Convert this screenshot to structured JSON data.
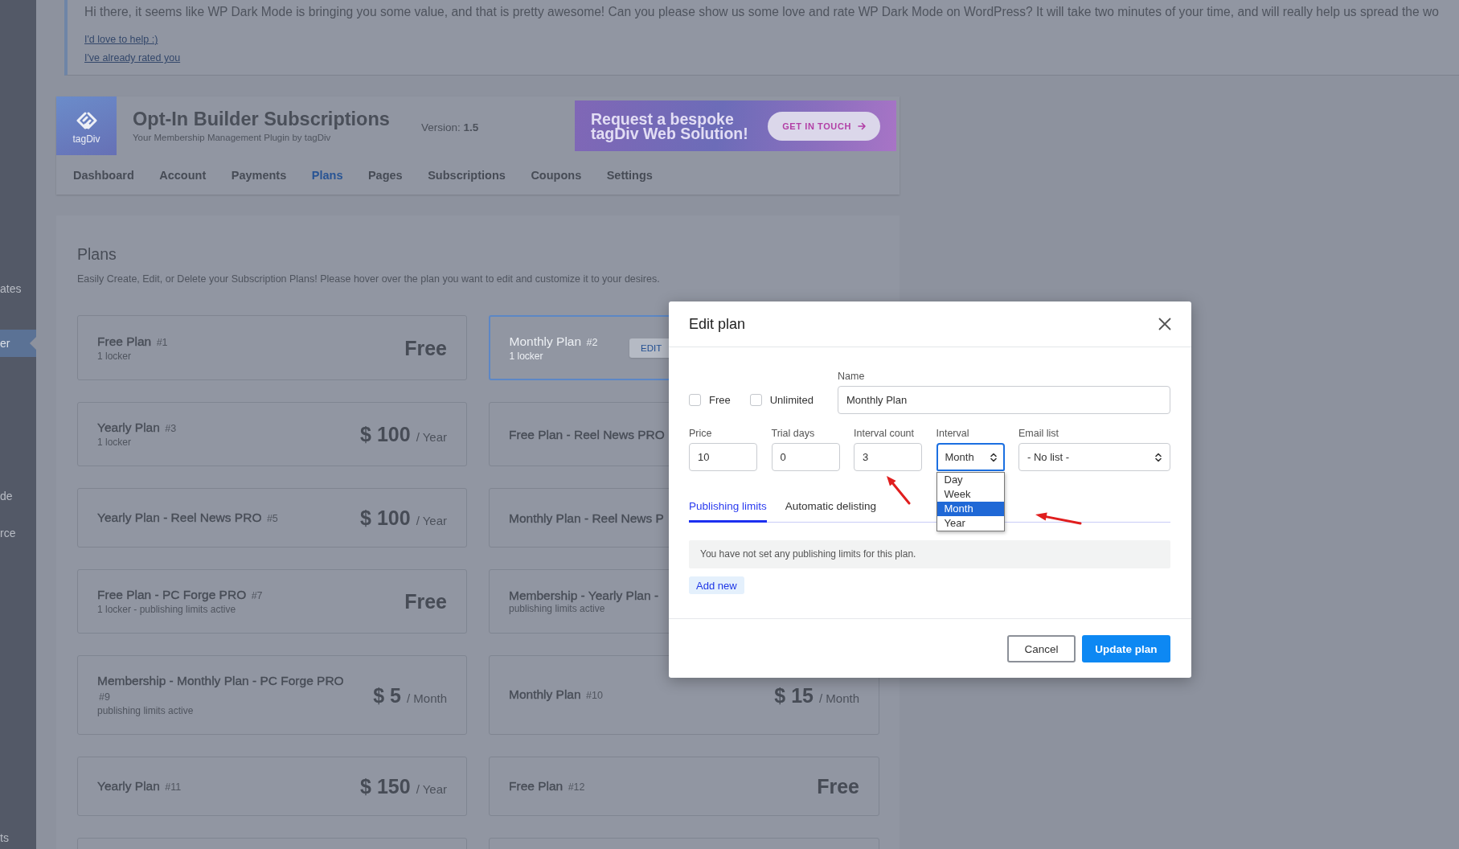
{
  "sidebar": {
    "items": [
      {
        "label": "ates",
        "selected": false
      },
      {
        "label": "er",
        "selected": true
      },
      {
        "label": "de",
        "selected": false
      },
      {
        "label": "rce",
        "selected": false
      },
      {
        "label": "ts",
        "selected": false
      }
    ]
  },
  "notice": {
    "text": "Hi there, it seems like WP Dark Mode is bringing you some value, and that is pretty awesome! Can you please show us some love and rate WP Dark Mode on WordPress? It will take two minutes of your time, and will really help us spread the wo",
    "links": [
      "I'd love to help :)",
      "I've already rated you"
    ]
  },
  "header": {
    "logo_text": "tagDiv",
    "title": "Opt-In Builder Subscriptions",
    "subtitle": "Your Membership Management Plugin by tagDiv",
    "version": "Version: **1.5**",
    "banner": {
      "headline": "Request a bespoke tagDiv Web Solution!",
      "button": "GET IN TOUCH"
    },
    "nav": [
      {
        "label": "Dashboard",
        "selected": false
      },
      {
        "label": "Account",
        "selected": false
      },
      {
        "label": "Payments",
        "selected": false
      },
      {
        "label": "Plans",
        "selected": true
      },
      {
        "label": "Pages",
        "selected": false
      },
      {
        "label": "Subscriptions",
        "selected": false
      },
      {
        "label": "Coupons",
        "selected": false
      },
      {
        "label": "Settings",
        "selected": false
      }
    ]
  },
  "plans": {
    "title": "Plans",
    "description": "Easily Create, Edit, or Delete your Subscription Plans! Please hover over the plan you want to edit and customize it to your desires.",
    "cards": [
      {
        "kind": "plan",
        "name": "Free Plan",
        "number": "#1",
        "meta": "1 locker",
        "price": "Free",
        "hovered": false
      },
      {
        "kind": "plan",
        "name": "Monthly Plan",
        "number": "#2",
        "meta": "1 locker",
        "hovered": true,
        "actions": [
          {
            "kind": "edit",
            "label": "EDIT"
          }
        ]
      },
      {
        "kind": "plan",
        "name": "Yearly Plan",
        "number": "#3",
        "meta": "1 locker",
        "price": "$ 100",
        "period": "/ Year",
        "hovered": false
      },
      {
        "kind": "plan",
        "name": "Free Plan - Reel News PRO",
        "hovered": false
      },
      {
        "kind": "plan",
        "name": "Yearly Plan - Reel News PRO",
        "number": "#5",
        "price": "$ 100",
        "period": "/ Year",
        "hovered": false
      },
      {
        "kind": "plan",
        "name": "Monthly Plan - Reel News P",
        "hovered": false
      },
      {
        "kind": "plan",
        "name": "Free Plan - PC Forge PRO",
        "number": "#7",
        "meta": "1 locker - publishing limits active",
        "price": "Free",
        "hovered": false
      },
      {
        "kind": "plan",
        "name": "Membership - Yearly Plan -",
        "meta": "publishing limits active",
        "hovered": false
      },
      {
        "kind": "plan",
        "name": "Membership - Monthly Plan - PC Forge PRO",
        "number": "#9",
        "meta": "publishing limits active",
        "price": "$ 5",
        "period": "/ Month",
        "hovered": false
      },
      {
        "kind": "plan",
        "name": "Monthly Plan",
        "number": "#10",
        "price": "$ 15",
        "period": "/ Month",
        "hovered": false
      },
      {
        "kind": "plan",
        "name": "Yearly Plan",
        "number": "#11",
        "price": "$ 150",
        "period": "/ Year",
        "hovered": false
      },
      {
        "kind": "plan",
        "name": "Free Plan",
        "number": "#12",
        "price": "Free",
        "hovered": false
      },
      {
        "kind": "empty",
        "hovered": false
      },
      {
        "kind": "empty",
        "hovered": false
      }
    ]
  },
  "modal": {
    "title": "Edit plan",
    "checkboxes": [
      {
        "label": "Free",
        "checked": false
      },
      {
        "label": "Unlimited",
        "checked": false
      }
    ],
    "name_field": {
      "label": "Name",
      "value": "Monthly Plan"
    },
    "fields": [
      {
        "kind": "input",
        "label": "Price",
        "value": "10",
        "focused": false
      },
      {
        "kind": "input",
        "label": "Trial days",
        "value": "0",
        "focused": false
      },
      {
        "kind": "input",
        "label": "Interval count",
        "value": "3",
        "focused": false
      },
      {
        "kind": "select",
        "label": "Interval",
        "value": "Month",
        "focused": true,
        "expanded": true,
        "options": [
          {
            "label": "Day",
            "selected": false
          },
          {
            "label": "Week",
            "selected": false
          },
          {
            "label": "Month",
            "selected": true
          },
          {
            "label": "Year",
            "selected": false
          }
        ]
      },
      {
        "kind": "select",
        "label": "Email list",
        "value": "- No list -",
        "focused": false,
        "expanded": false
      }
    ],
    "tabs": [
      {
        "label": "Publishing limits",
        "selected": true
      },
      {
        "label": "Automatic delisting",
        "selected": false
      }
    ],
    "empty_message": "You have not set any publishing limits for this plan.",
    "add_button": "Add new",
    "buttons": [
      {
        "kind": "secondary",
        "label": "Cancel"
      },
      {
        "kind": "primary",
        "label": "Update plan"
      }
    ]
  }
}
